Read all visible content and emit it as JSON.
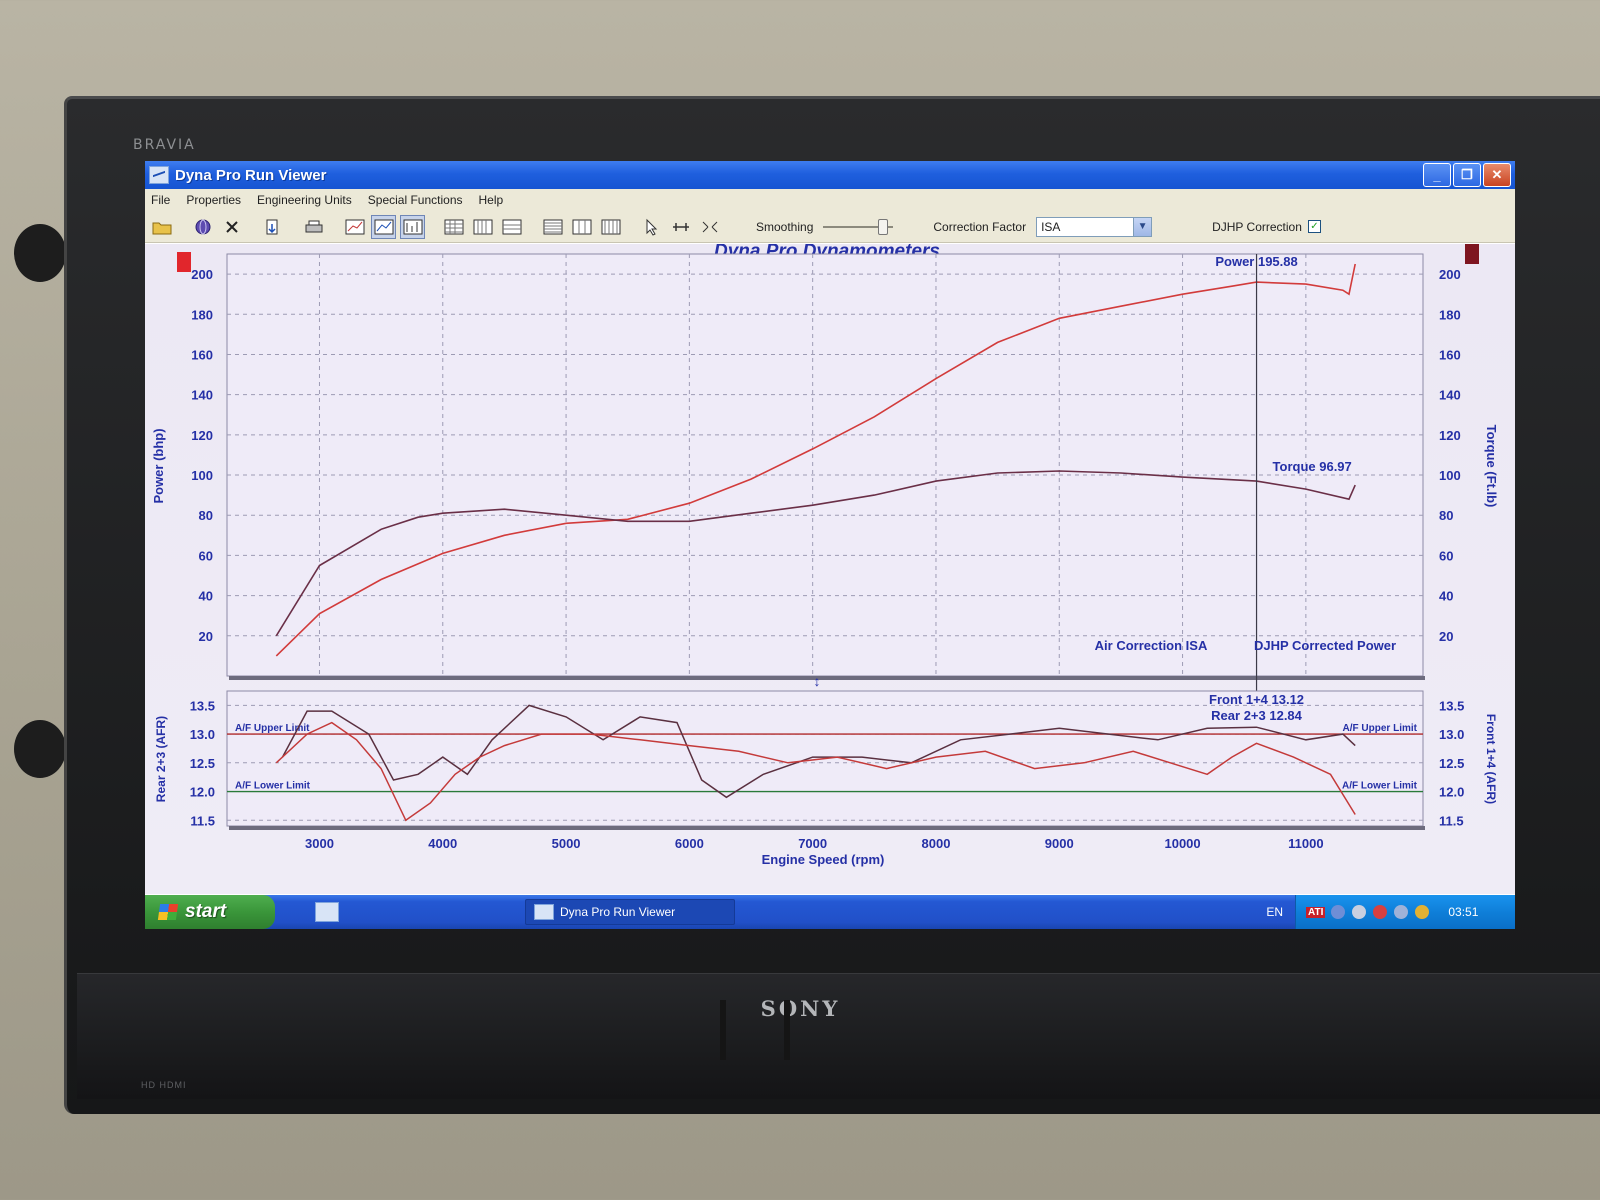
{
  "tv": {
    "brand_top": "BRAVIA",
    "brand_bottom": "SONY",
    "ports_label": "HD HDMI"
  },
  "window": {
    "title": "Dyna Pro Run Viewer",
    "controls": {
      "minimize": "_",
      "maximize": "❐",
      "close": "✕"
    }
  },
  "menu": {
    "items": [
      "File",
      "Properties",
      "Engineering Units",
      "Special Functions",
      "Help"
    ]
  },
  "toolbar": {
    "smoothing_label": "Smoothing",
    "smoothing_level": 0.85,
    "correction_factor_label": "Correction Factor",
    "correction_factor_value": "ISA",
    "djhp_label": "DJHP Correction",
    "djhp_checked": true,
    "icons": [
      "open-folder-icon",
      "globe-icon",
      "delete-icon",
      "import-icon",
      "print-icon",
      "graph-icon",
      "graph-zoom-icon",
      "graph-compare-icon",
      "grid-icon-1",
      "grid-icon-2",
      "grid-icon-3",
      "table-icon-1",
      "table-icon-2",
      "table-icon-3",
      "cursor-icon",
      "measure-icon",
      "fit-icon"
    ]
  },
  "chart": {
    "title": "Dyna Pro Dynamometers",
    "bg_color": "#ece8f4",
    "power_color": "#d23b3b",
    "torque_color": "#6a2f47",
    "axis_text_color": "#2530a6",
    "cursor_rpm": 10600,
    "footer_left": "Air Correction ISA",
    "footer_right": "DJHP Corrected Power"
  },
  "chart_data": [
    {
      "type": "line",
      "title": "Dyna Pro Dynamometers",
      "xlabel": "Engine Speed (rpm)",
      "ylabel": "Power (bhp)",
      "ylabel_right": "Torque (Ft.lb)",
      "xlim": [
        2250,
        11950
      ],
      "ylim": [
        0,
        210
      ],
      "x_ticks": [
        3000,
        4000,
        5000,
        6000,
        7000,
        8000,
        9000,
        10000,
        11000
      ],
      "y_ticks": [
        20,
        40,
        60,
        80,
        100,
        120,
        140,
        160,
        180,
        200
      ],
      "grid": true,
      "series": [
        {
          "name": "Power",
          "readout": "Power 195.88",
          "points": [
            [
              2650,
              10
            ],
            [
              3000,
              31
            ],
            [
              3500,
              48
            ],
            [
              4000,
              61
            ],
            [
              4500,
              70
            ],
            [
              5000,
              76
            ],
            [
              5500,
              78
            ],
            [
              6000,
              86
            ],
            [
              6500,
              98
            ],
            [
              7000,
              113
            ],
            [
              7500,
              129
            ],
            [
              8000,
              148
            ],
            [
              8500,
              166
            ],
            [
              9000,
              178
            ],
            [
              9500,
              184
            ],
            [
              10000,
              190
            ],
            [
              10400,
              194
            ],
            [
              10600,
              196
            ],
            [
              11000,
              195
            ],
            [
              11300,
              192
            ],
            [
              11350,
              190
            ],
            [
              11400,
              205
            ]
          ]
        },
        {
          "name": "Torque",
          "readout": "Torque 96.97",
          "points": [
            [
              2650,
              20
            ],
            [
              3000,
              55
            ],
            [
              3500,
              73
            ],
            [
              3800,
              79
            ],
            [
              4000,
              81
            ],
            [
              4500,
              83
            ],
            [
              5000,
              80
            ],
            [
              5500,
              77
            ],
            [
              6000,
              77
            ],
            [
              6500,
              81
            ],
            [
              7000,
              85
            ],
            [
              7500,
              90
            ],
            [
              8000,
              97
            ],
            [
              8500,
              101
            ],
            [
              9000,
              102
            ],
            [
              9500,
              101
            ],
            [
              10000,
              99
            ],
            [
              10600,
              97
            ],
            [
              11000,
              93
            ],
            [
              11350,
              88
            ],
            [
              11400,
              95
            ]
          ]
        }
      ]
    },
    {
      "type": "line",
      "xlabel": "Engine Speed (rpm)",
      "ylabel": "Rear 2+3 (AFR)",
      "ylabel_right": "Front 1+4 (AFR)",
      "xlim": [
        2250,
        11950
      ],
      "ylim": [
        11.4,
        13.75
      ],
      "y_ticks": [
        11.5,
        12.0,
        12.5,
        13.0,
        13.5
      ],
      "x_ticks": [
        3000,
        4000,
        5000,
        6000,
        7000,
        8000,
        9000,
        10000,
        11000
      ],
      "limits": [
        {
          "name": "A/F Upper Limit",
          "value": 13.0,
          "color": "#b12b2b"
        },
        {
          "name": "A/F Lower Limit",
          "value": 12.0,
          "color": "#2a7a3a"
        }
      ],
      "series": [
        {
          "name": "Front 1+4",
          "readout": "Front 1+4 13.12",
          "color": "#5a3040",
          "points": [
            [
              2700,
              12.6
            ],
            [
              2900,
              13.4
            ],
            [
              3100,
              13.4
            ],
            [
              3400,
              13.0
            ],
            [
              3600,
              12.2
            ],
            [
              3800,
              12.3
            ],
            [
              4000,
              12.6
            ],
            [
              4200,
              12.3
            ],
            [
              4400,
              12.9
            ],
            [
              4700,
              13.5
            ],
            [
              5000,
              13.3
            ],
            [
              5300,
              12.9
            ],
            [
              5600,
              13.3
            ],
            [
              5900,
              13.2
            ],
            [
              6100,
              12.2
            ],
            [
              6300,
              11.9
            ],
            [
              6600,
              12.3
            ],
            [
              7000,
              12.6
            ],
            [
              7400,
              12.6
            ],
            [
              7800,
              12.5
            ],
            [
              8200,
              12.9
            ],
            [
              8600,
              13.0
            ],
            [
              9000,
              13.1
            ],
            [
              9400,
              13.0
            ],
            [
              9800,
              12.9
            ],
            [
              10200,
              13.1
            ],
            [
              10600,
              13.12
            ],
            [
              11000,
              12.9
            ],
            [
              11300,
              13.0
            ],
            [
              11400,
              12.8
            ]
          ]
        },
        {
          "name": "Rear 2+3",
          "readout": "Rear 2+3 12.84",
          "color": "#c43a3a",
          "points": [
            [
              2650,
              12.5
            ],
            [
              2900,
              13.0
            ],
            [
              3100,
              13.2
            ],
            [
              3300,
              12.9
            ],
            [
              3500,
              12.4
            ],
            [
              3700,
              11.5
            ],
            [
              3900,
              11.8
            ],
            [
              4100,
              12.3
            ],
            [
              4300,
              12.6
            ],
            [
              4500,
              12.8
            ],
            [
              4800,
              13.0
            ],
            [
              5200,
              13.0
            ],
            [
              5600,
              12.9
            ],
            [
              6000,
              12.8
            ],
            [
              6400,
              12.7
            ],
            [
              6800,
              12.5
            ],
            [
              7200,
              12.6
            ],
            [
              7600,
              12.4
            ],
            [
              8000,
              12.6
            ],
            [
              8400,
              12.7
            ],
            [
              8800,
              12.4
            ],
            [
              9200,
              12.5
            ],
            [
              9600,
              12.7
            ],
            [
              9900,
              12.5
            ],
            [
              10200,
              12.3
            ],
            [
              10400,
              12.6
            ],
            [
              10600,
              12.84
            ],
            [
              10900,
              12.6
            ],
            [
              11200,
              12.3
            ],
            [
              11400,
              11.6
            ]
          ]
        }
      ]
    }
  ],
  "taskbar": {
    "start_label": "start",
    "task_label": "Dyna Pro Run Viewer",
    "lang": "EN",
    "tray_ati": "ATI",
    "clock": "03:51"
  }
}
